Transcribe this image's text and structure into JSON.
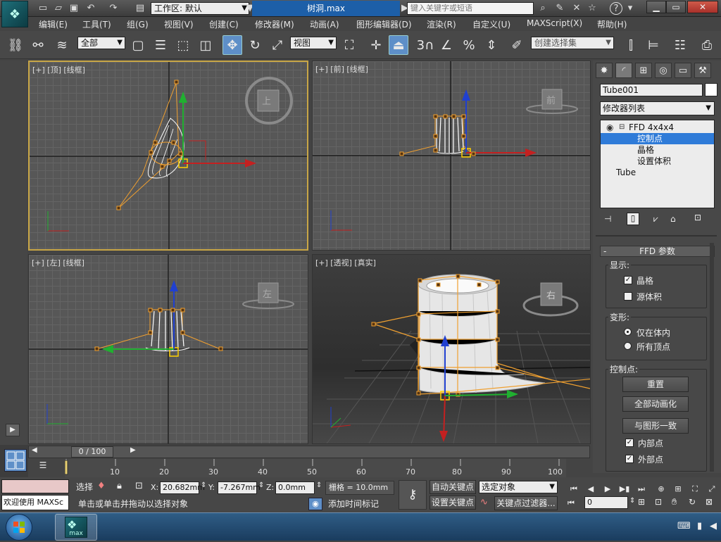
{
  "title_bar": {
    "workspace_label": "工作区: 默认",
    "filename": "树洞.max",
    "search_placeholder": "键入关键字或短语"
  },
  "menu": [
    "编辑(E)",
    "工具(T)",
    "组(G)",
    "视图(V)",
    "创建(C)",
    "修改器(M)",
    "动画(A)",
    "图形编辑器(D)",
    "渲染(R)",
    "自定义(U)",
    "MAXScript(X)",
    "帮助(H)"
  ],
  "toolbar": {
    "selection_filter": "全部",
    "ref_coord": "视图",
    "snap_angle": "3",
    "named_selection_placeholder": "创建选择集"
  },
  "viewports": {
    "top": "[+] [顶] [线框]",
    "front": "[+] [前] [线框]",
    "left": "[+] [左] [线框]",
    "persp": "[+] [透视] [真实]",
    "viewcube_top": "上",
    "viewcube_front": "前",
    "viewcube_left": "左",
    "viewcube_persp": "右"
  },
  "command_panel": {
    "object_name": "Tube001",
    "modifier_list": "修改器列表",
    "stack": {
      "ffd": "FFD 4x4x4",
      "control_points": "控制点",
      "lattice": "晶格",
      "set_volume": "设置体积",
      "base": "Tube"
    },
    "rollout_title": "FFD 参数",
    "rollout_toggle": "-",
    "display_group": "显示:",
    "lattice_chk": "晶格",
    "source_volume_chk": "源体积",
    "deform_group": "变形:",
    "only_in_volume": "仅在体内",
    "all_vertices": "所有顶点",
    "control_points_group": "控制点:",
    "reset_btn": "重置",
    "animate_all_btn": "全部动画化",
    "conform_btn": "与图形一致",
    "inside_chk": "内部点",
    "outside_chk": "外部点"
  },
  "timeline": {
    "frame_display": "0 / 100",
    "ticks": [
      "10",
      "20",
      "30",
      "40",
      "50",
      "60",
      "70",
      "80",
      "90",
      "100"
    ]
  },
  "status": {
    "listener_text": "欢迎使用 MAXSc",
    "selected_label": "选择",
    "x_label": "X:",
    "x_value": "20.682mm",
    "y_label": "Y:",
    "y_value": "-7.267mm",
    "z_label": "Z:",
    "z_value": "0.0mm",
    "grid_label": "栅格 = 10.0mm",
    "prompt": "单击或单击并拖动以选择对象",
    "add_time_tag": "添加时间标记",
    "auto_key": "自动关键点",
    "set_key": "设置关键点",
    "selected_object": "选定对象",
    "key_filters": "关键点过滤器...",
    "frame_field": "0"
  },
  "taskbar": {
    "app_label": "max"
  },
  "colors": {
    "accent": "#2f7bd8",
    "active_viewport_border": "#c8a646",
    "lattice": "#f0a030"
  }
}
